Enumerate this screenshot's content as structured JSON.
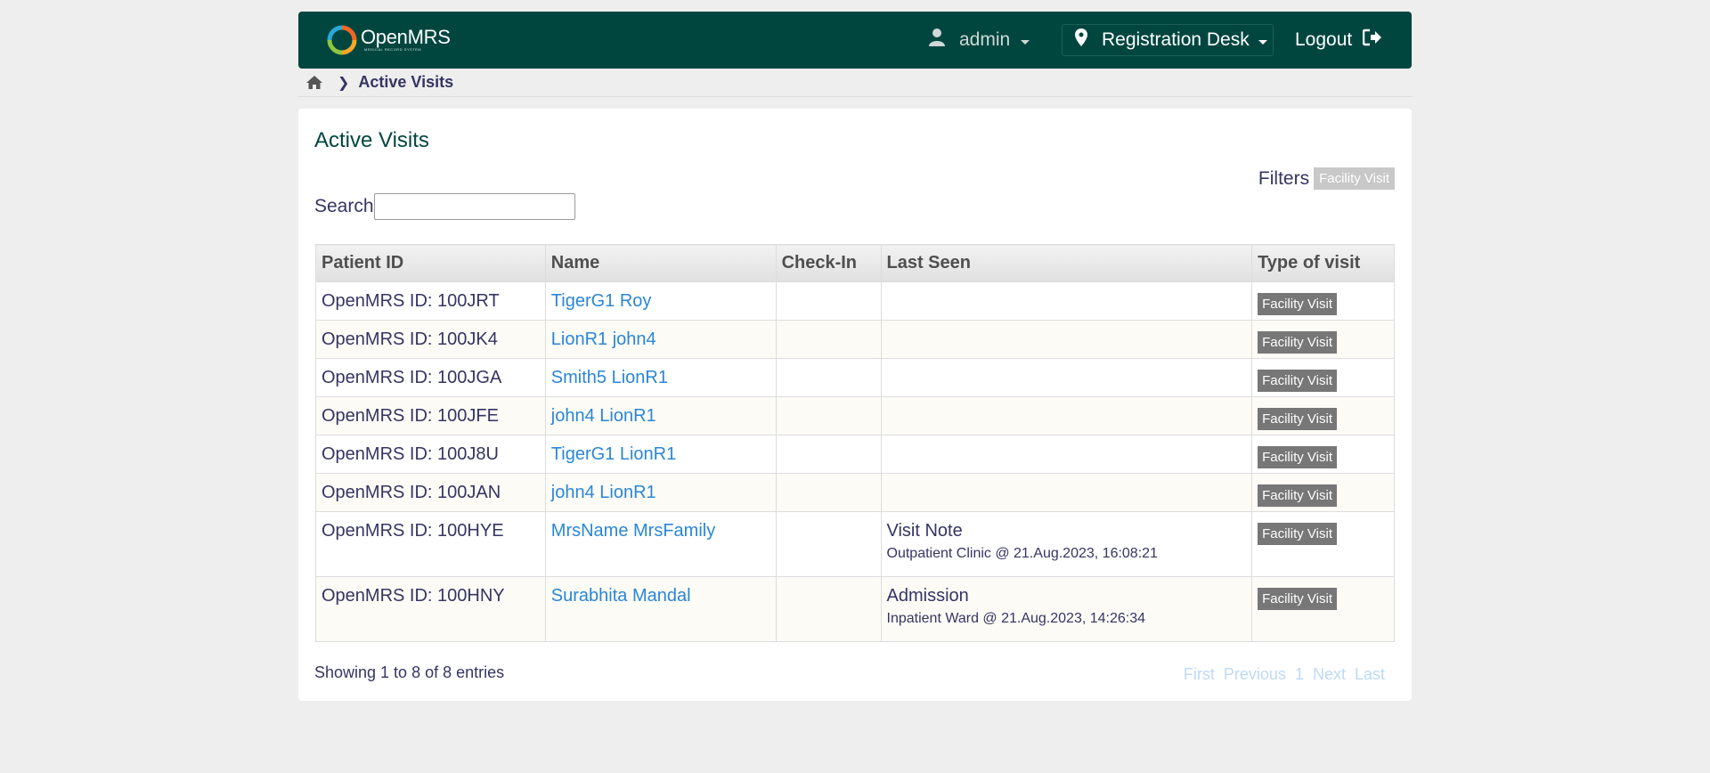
{
  "header": {
    "logo_text": "OpenMRS",
    "logo_subtitle": "MEDICAL RECORD SYSTEM",
    "user": "admin",
    "location": "Registration Desk",
    "logout": "Logout"
  },
  "breadcrumb": {
    "current": "Active Visits"
  },
  "page": {
    "title": "Active Visits",
    "filters_label": "Filters",
    "filter_tag": "Facility Visit",
    "search_label": "Search",
    "search_value": ""
  },
  "table": {
    "headers": [
      "Patient ID",
      "Name",
      "Check-In",
      "Last Seen",
      "Type of visit"
    ],
    "rows": [
      {
        "patient_id": "OpenMRS ID: 100JRT",
        "name": "TigerG1 Roy",
        "check_in": "",
        "last_seen": "",
        "last_seen_detail": "",
        "type": "Facility Visit"
      },
      {
        "patient_id": "OpenMRS ID: 100JK4",
        "name": "LionR1 john4",
        "check_in": "",
        "last_seen": "",
        "last_seen_detail": "",
        "type": "Facility Visit"
      },
      {
        "patient_id": "OpenMRS ID: 100JGA",
        "name": "Smith5 LionR1",
        "check_in": "",
        "last_seen": "",
        "last_seen_detail": "",
        "type": "Facility Visit"
      },
      {
        "patient_id": "OpenMRS ID: 100JFE",
        "name": "john4 LionR1",
        "check_in": "",
        "last_seen": "",
        "last_seen_detail": "",
        "type": "Facility Visit"
      },
      {
        "patient_id": "OpenMRS ID: 100J8U",
        "name": "TigerG1 LionR1",
        "check_in": "",
        "last_seen": "",
        "last_seen_detail": "",
        "type": "Facility Visit"
      },
      {
        "patient_id": "OpenMRS ID: 100JAN",
        "name": "john4 LionR1",
        "check_in": "",
        "last_seen": "",
        "last_seen_detail": "",
        "type": "Facility Visit"
      },
      {
        "patient_id": "OpenMRS ID: 100HYE",
        "name": "MrsName MrsFamily",
        "check_in": "",
        "last_seen": "Visit Note",
        "last_seen_detail": "Outpatient Clinic @ 21.Aug.2023, 16:08:21",
        "type": "Facility Visit"
      },
      {
        "patient_id": "OpenMRS ID: 100HNY",
        "name": "Surabhita Mandal",
        "check_in": "",
        "last_seen": "Admission",
        "last_seen_detail": "Inpatient Ward @ 21.Aug.2023, 14:26:34",
        "type": "Facility Visit"
      }
    ]
  },
  "footer": {
    "showing": "Showing 1 to 8 of 8 entries",
    "pager": {
      "first": "First",
      "previous": "Previous",
      "page": "1",
      "next": "Next",
      "last": "Last"
    }
  },
  "colors": {
    "header_bg": "#00463f",
    "link": "#2a86d6",
    "badge": "#777777",
    "filter_badge": "#c8c8c8",
    "pager_disabled": "#bcdaf6"
  }
}
